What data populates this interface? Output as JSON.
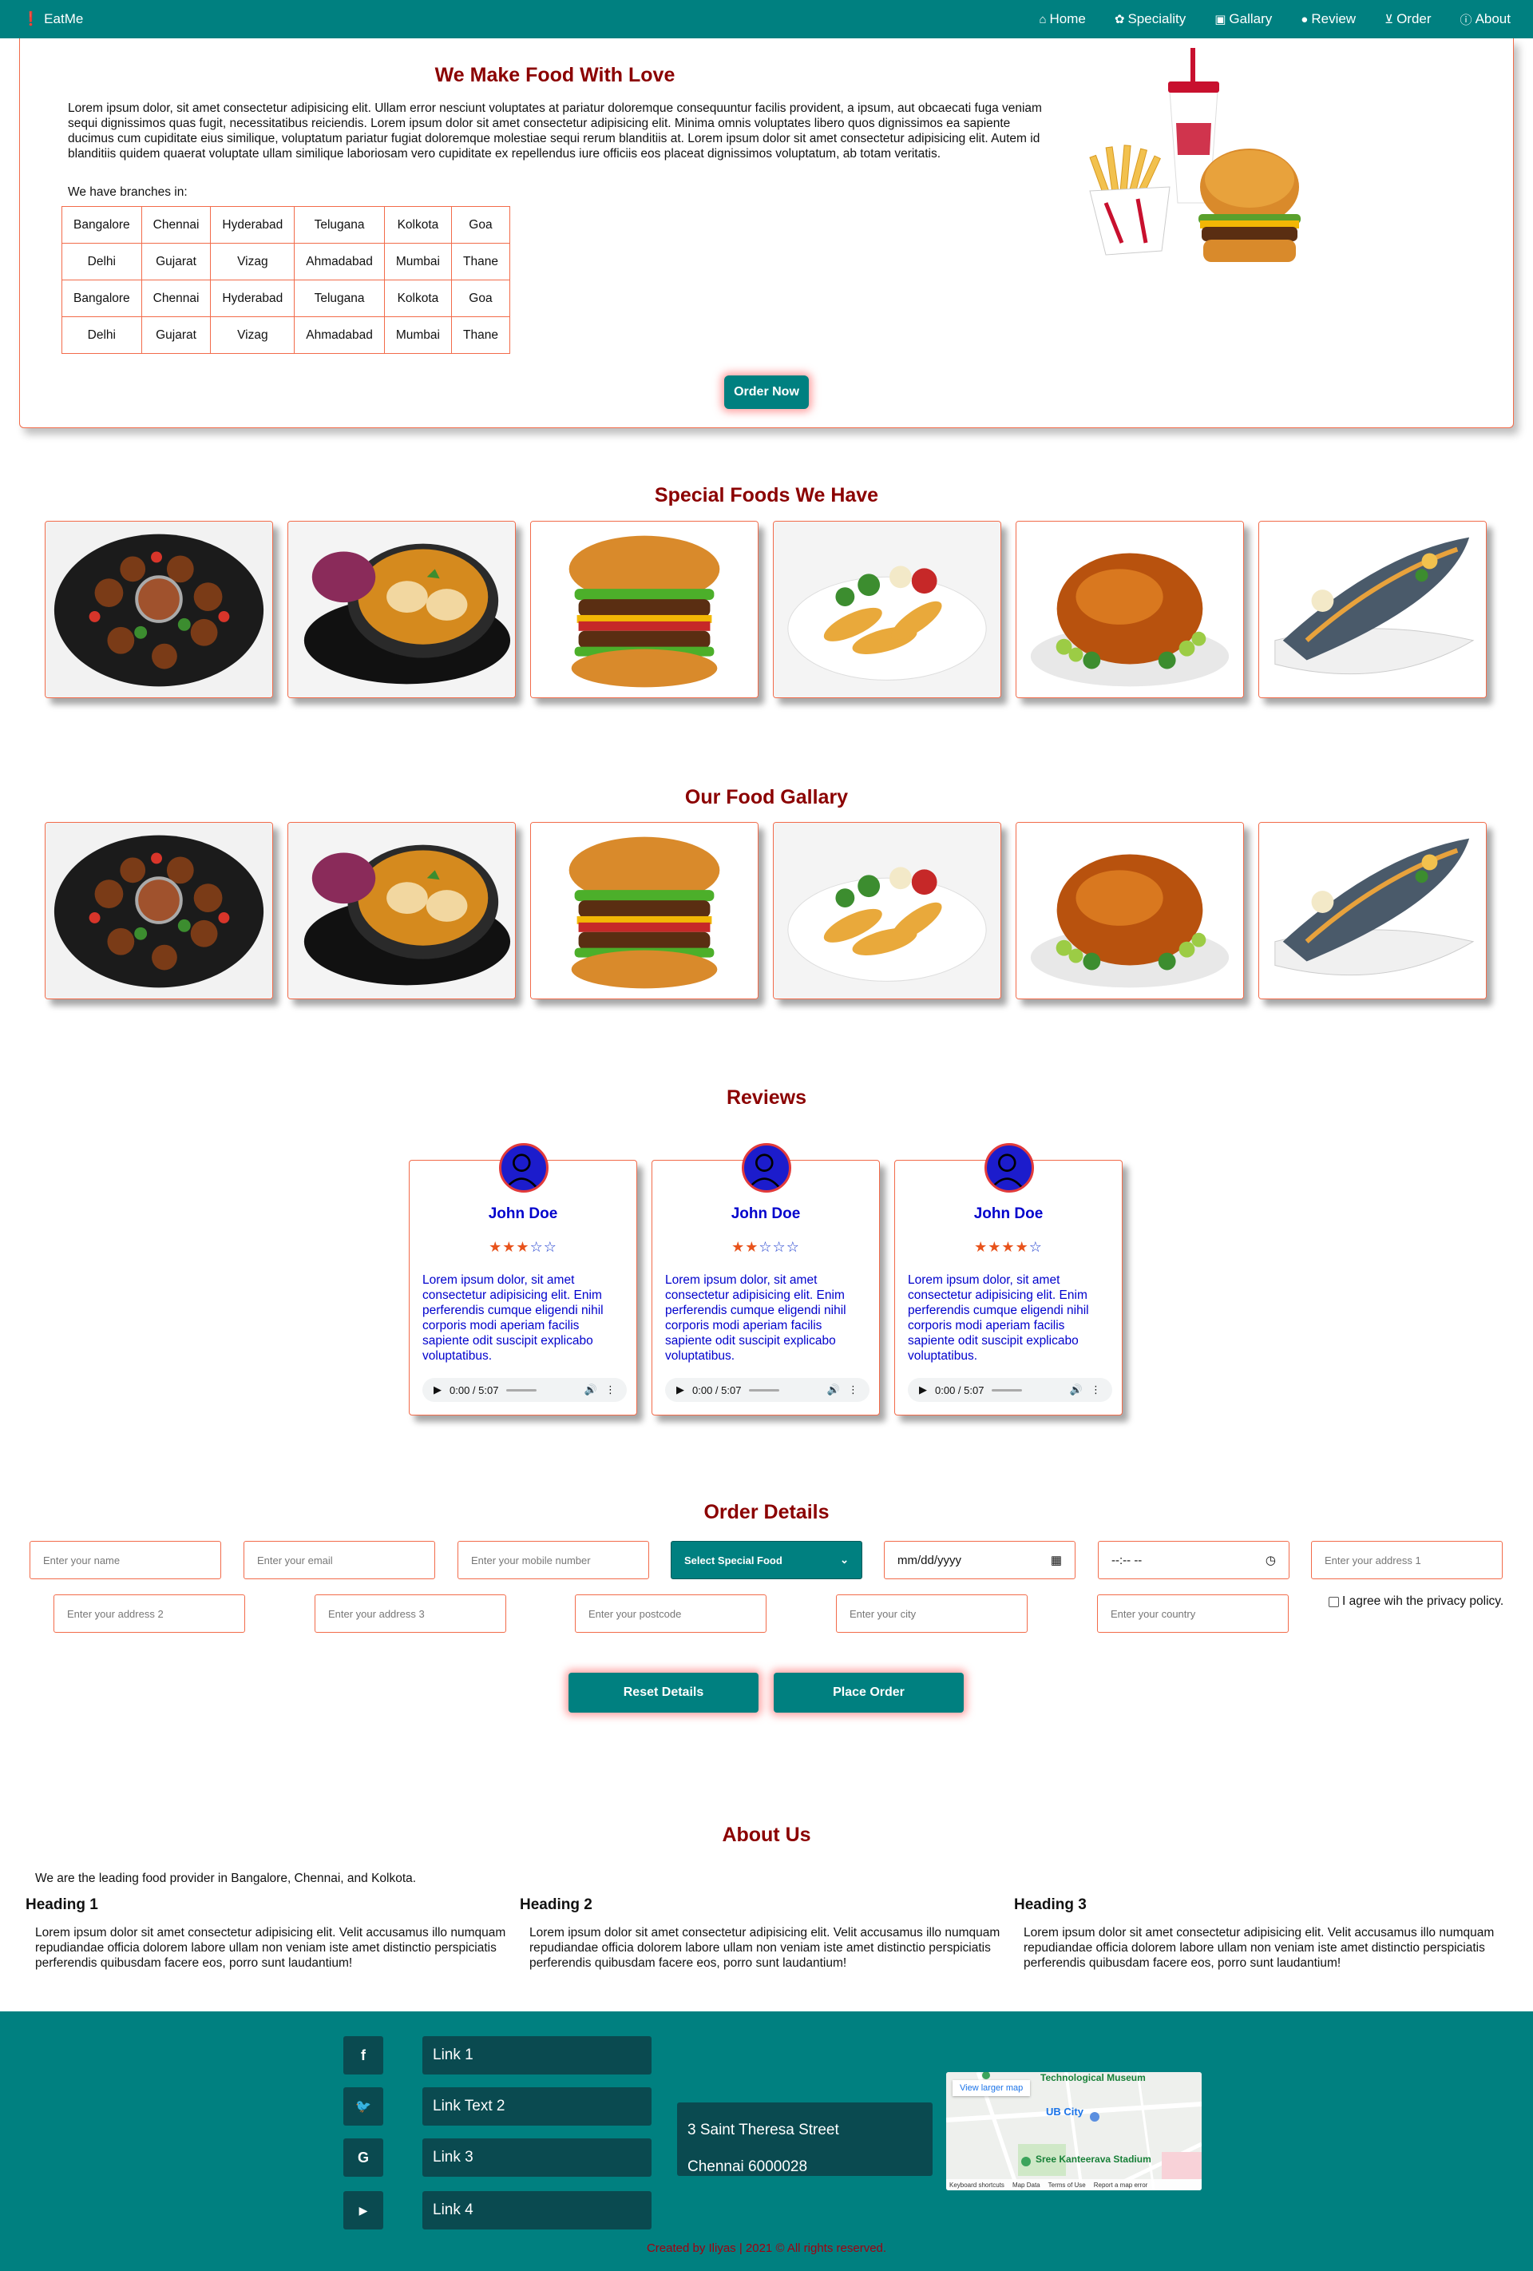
{
  "navbar": {
    "brand": "EatMe",
    "items": [
      {
        "label": "Home",
        "icon": "home-icon"
      },
      {
        "label": "Speciality",
        "icon": "gift-icon"
      },
      {
        "label": "Gallary",
        "icon": "image-icon"
      },
      {
        "label": "Review",
        "icon": "comments-icon"
      },
      {
        "label": "Order",
        "icon": "cart-icon"
      },
      {
        "label": "About",
        "icon": "info-icon"
      }
    ]
  },
  "hero": {
    "title": "We Make Food With Love",
    "text": "Lorem ipsum dolor, sit amet consectetur adipisicing elit. Ullam error nesciunt voluptates at pariatur doloremque consequuntur facilis provident, a ipsum, aut obcaecati fuga veniam sequi dignissimos quas fugit, necessitatibus reiciendis. Lorem ipsum dolor sit amet consectetur adipisicing elit. Minima omnis voluptates libero quos dignissimos ea sapiente ducimus cum cupiditate eius similique, voluptatum pariatur fugiat doloremque molestiae sequi rerum blanditiis at. Lorem ipsum dolor sit amet consectetur adipisicing elit. Autem id blanditiis quidem quaerat voluptate ullam similique laboriosam vero cupiditate ex repellendus iure officiis eos placeat dignissimos voluptatum, ab totam veritatis.",
    "branches_label": "We have branches in:",
    "branches": [
      [
        "Bangalore",
        "Chennai",
        "Hyderabad",
        "Telugana",
        "Kolkota",
        "Goa"
      ],
      [
        "Delhi",
        "Gujarat",
        "Vizag",
        "Ahmadabad",
        "Mumbai",
        "Thane"
      ],
      [
        "Bangalore",
        "Chennai",
        "Hyderabad",
        "Telugana",
        "Kolkota",
        "Goa"
      ],
      [
        "Delhi",
        "Gujarat",
        "Vizag",
        "Ahmadabad",
        "Mumbai",
        "Thane"
      ]
    ],
    "order_button": "Order Now"
  },
  "special": {
    "title": "Special Foods We Have"
  },
  "gallery": {
    "title": "Our Food Gallary"
  },
  "reviews": {
    "title": "Reviews",
    "items": [
      {
        "name": "John Doe",
        "rating": 3,
        "text": "Lorem ipsum dolor, sit amet consectetur adipisicing elit. Enim perferendis cumque eligendi nihil corporis modi aperiam facilis sapiente odit suscipit explicabo voluptatibus.",
        "audio_time": "0:00 / 5:07"
      },
      {
        "name": "John Doe",
        "rating": 2,
        "text": "Lorem ipsum dolor, sit amet consectetur adipisicing elit. Enim perferendis cumque eligendi nihil corporis modi aperiam facilis sapiente odit suscipit explicabo voluptatibus.",
        "audio_time": "0:00 / 5:07"
      },
      {
        "name": "John Doe",
        "rating": 4,
        "text": "Lorem ipsum dolor, sit amet consectetur adipisicing elit. Enim perferendis cumque eligendi nihil corporis modi aperiam facilis sapiente odit suscipit explicabo voluptatibus.",
        "audio_time": "0:00 / 5:07"
      }
    ]
  },
  "order": {
    "title": "Order Details",
    "name_placeholder": "Enter your name",
    "email_placeholder": "Enter your email",
    "mobile_placeholder": "Enter your mobile number",
    "special_select": "Select Special Food",
    "date_placeholder": "mm/dd/yyyy",
    "time_placeholder": "--:-- --",
    "address1_placeholder": "Enter your address 1",
    "address2_placeholder": "Enter your address 2",
    "address3_placeholder": "Enter your address 3",
    "postcode_placeholder": "Enter your postcode",
    "city_placeholder": "Enter your city",
    "country_placeholder": "Enter your country",
    "agree_label": "I agree wih the privacy policy.",
    "reset_label": "Reset Details",
    "place_label": "Place Order"
  },
  "about": {
    "title": "About Us",
    "text": "We are the leading food provider in Bangalore, Chennai, and Kolkota.",
    "columns": [
      {
        "heading": "Heading 1",
        "text": "Lorem ipsum dolor sit amet consectetur adipisicing elit. Velit accusamus illo numquam repudiandae officia dolorem labore ullam non veniam iste amet distinctio perspiciatis perferendis quibusdam facere eos, porro sunt laudantium!"
      },
      {
        "heading": "Heading 2",
        "text": "Lorem ipsum dolor sit amet consectetur adipisicing elit. Velit accusamus illo numquam repudiandae officia dolorem labore ullam non veniam iste amet distinctio perspiciatis perferendis quibusdam facere eos, porro sunt laudantium!"
      },
      {
        "heading": "Heading 3",
        "text": "Lorem ipsum dolor sit amet consectetur adipisicing elit. Velit accusamus illo numquam repudiandae officia dolorem labore ullam non veniam iste amet distinctio perspiciatis perferendis quibusdam facere eos, porro sunt laudantium!"
      }
    ]
  },
  "footer": {
    "social": [
      {
        "icon": "facebook-icon",
        "glyph": "f"
      },
      {
        "icon": "twitter-icon",
        "glyph": "🐦"
      },
      {
        "icon": "google-icon",
        "glyph": "G"
      },
      {
        "icon": "youtube-icon",
        "glyph": "▶"
      }
    ],
    "links": [
      "Link 1",
      "Link Text 2",
      "Link 3",
      "Link 4"
    ],
    "address_line1": "3 Saint Theresa Street",
    "address_line2": "Chennai 6000028",
    "map": {
      "view_larger": "View larger map",
      "label_museum": "Technological Museum",
      "label_ubcity": "UB City",
      "label_stadium": "Sree Kanteerava Stadium",
      "footer_items": [
        "Keyboard shortcuts",
        "Map Data",
        "Terms of Use",
        "Report a map error"
      ]
    },
    "copyright": "Created by Iliyas | 2021 © All rights reserved."
  },
  "colors": {
    "teal": "#008080",
    "accent_border": "#f26b4a",
    "heading": "#8b0000",
    "review_text": "#0000cc"
  }
}
